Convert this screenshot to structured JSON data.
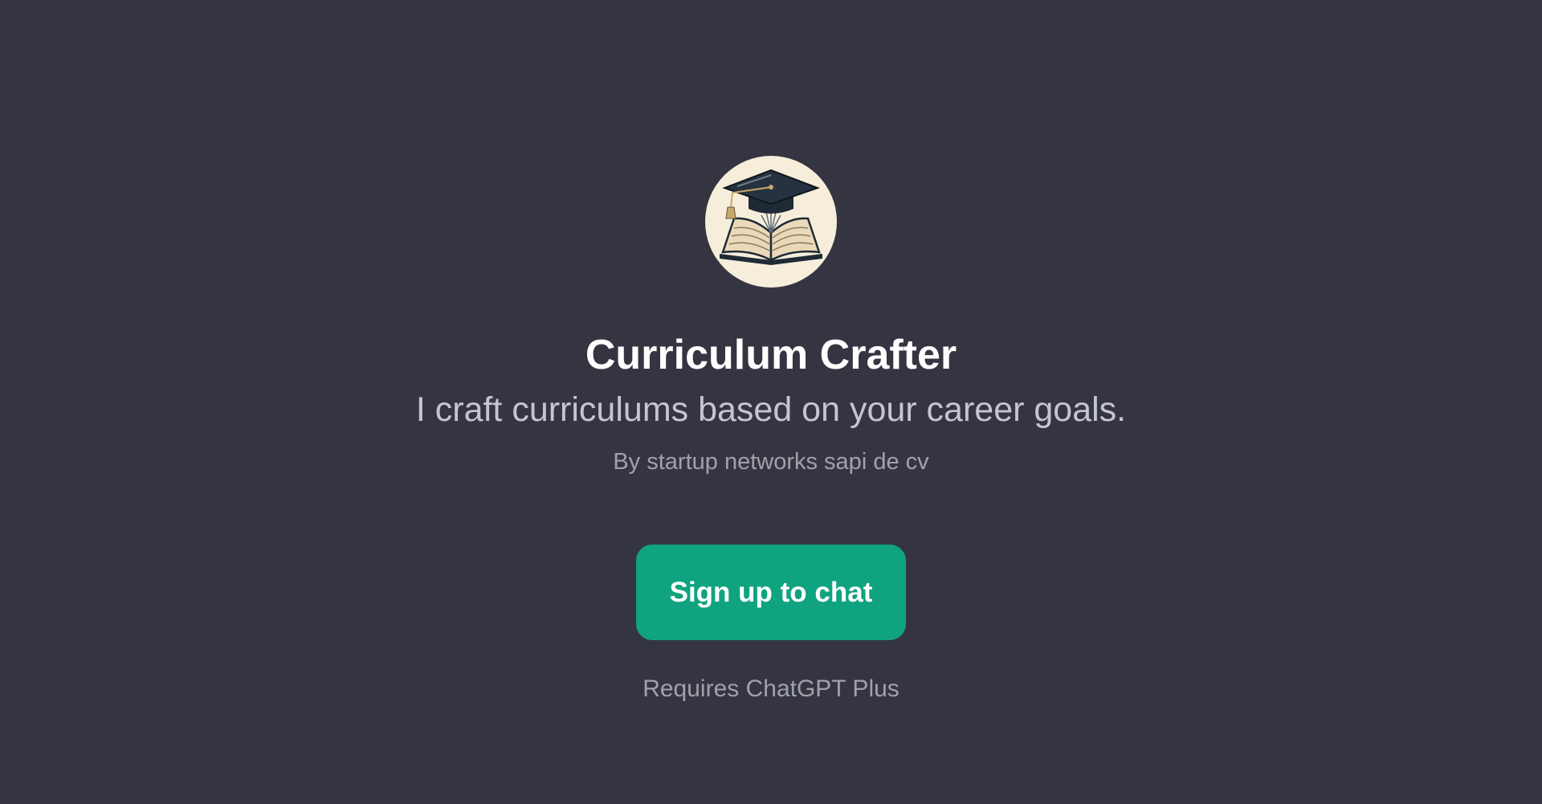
{
  "gpt": {
    "avatar_icon": "graduation-cap-on-open-book-icon",
    "title": "Curriculum Crafter",
    "description": "I craft curriculums based on your career goals.",
    "author": "By startup networks sapi de cv"
  },
  "cta": {
    "signup_label": "Sign up to chat",
    "requirement_note": "Requires ChatGPT Plus"
  },
  "colors": {
    "background": "#343541",
    "accent": "#10a37f",
    "title": "#ffffff",
    "subtitle": "#c5c5d2",
    "muted": "#a1a1ab"
  }
}
